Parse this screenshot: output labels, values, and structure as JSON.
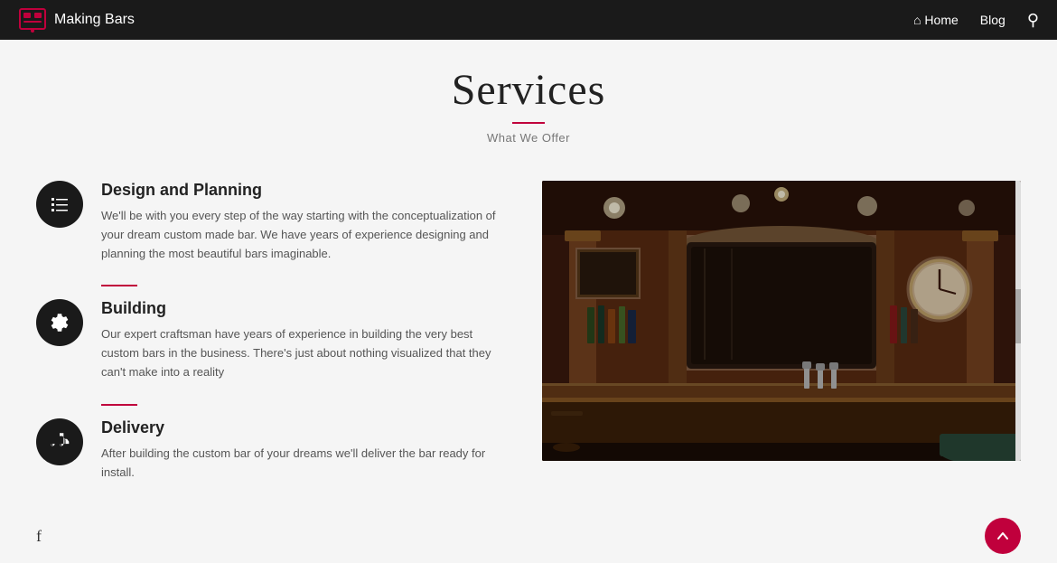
{
  "nav": {
    "logo_text": "Making Bars",
    "links": [
      {
        "label": "Home",
        "icon": "home"
      },
      {
        "label": "Blog",
        "icon": ""
      }
    ],
    "search_label": "search"
  },
  "page_header": {
    "title": "Services",
    "subtitle": "What We Offer"
  },
  "services": [
    {
      "id": "design-planning",
      "icon": "list",
      "title": "Design and Planning",
      "description": "We'll be with you every step of the way starting with the conceptualization of your dream custom made bar. We have years of experience designing and planning the most beautiful bars imaginable."
    },
    {
      "id": "building",
      "icon": "gear",
      "title": "Building",
      "description": "Our expert craftsman have years of experience in building the very best custom bars in the business. There's just about nothing visualized that they can't make into a reality"
    },
    {
      "id": "delivery",
      "icon": "truck",
      "title": "Delivery",
      "description": "After building the custom bar of your dreams we'll deliver the bar ready for install."
    }
  ],
  "colors": {
    "accent": "#c0003c",
    "nav_bg": "#1a1a1a",
    "icon_bg": "#1a1a1a"
  },
  "footer": {
    "facebook_label": "f",
    "fab_icon": "chevron-up"
  }
}
